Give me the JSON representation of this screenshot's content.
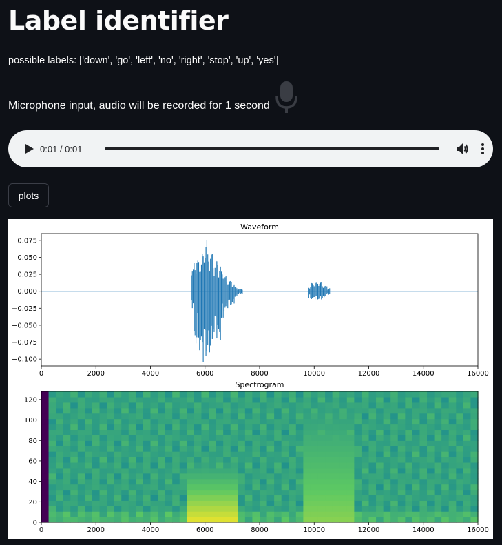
{
  "page": {
    "title": "Label identifier",
    "labels_text": "possible labels: ['down', 'go', 'left', 'no', 'right', 'stop', 'up', 'yes']",
    "mic_text": "Microphone input, audio will be recorded for 1 second",
    "mic_icon": "microphone-icon"
  },
  "audio": {
    "time": "0:01 / 0:01",
    "progress": 1.0,
    "icons": [
      "play-icon",
      "volume-icon",
      "more-vert-icon"
    ]
  },
  "plots_button": {
    "label": "plots"
  },
  "chart_data": [
    {
      "type": "line",
      "title": "Waveform",
      "xlabel": "",
      "ylabel": "",
      "xlim": [
        0,
        16000
      ],
      "ylim": [
        -0.11,
        0.085
      ],
      "xticks": [
        0,
        2000,
        4000,
        6000,
        8000,
        10000,
        12000,
        14000,
        16000
      ],
      "yticks": [
        -0.1,
        -0.075,
        -0.05,
        -0.025,
        0.0,
        0.025,
        0.05,
        0.075
      ],
      "xtick_labels": [
        "0",
        "2000",
        "4000",
        "6000",
        "8000",
        "10000",
        "12000",
        "14000",
        "16000"
      ],
      "ytick_labels": [
        "−0.100",
        "−0.075",
        "−0.050",
        "−0.025",
        "0.000",
        "0.025",
        "0.050",
        "0.075"
      ],
      "color": "#1f77b4",
      "series": [
        {
          "x": [
            0,
            5400,
            5500,
            5600,
            5700,
            5800,
            5900,
            6000,
            6100,
            6200,
            6300,
            6400,
            6500,
            6600,
            6700,
            6800,
            6900,
            7000,
            7100,
            7200,
            7400,
            9700,
            9800,
            9900,
            10000,
            10100,
            10200,
            10300,
            10400,
            10500,
            10600,
            10800,
            16000
          ],
          "y_max": [
            0.001,
            0.003,
            0.032,
            0.05,
            0.045,
            0.05,
            0.055,
            0.078,
            0.06,
            0.055,
            0.05,
            0.045,
            0.04,
            0.03,
            0.022,
            0.018,
            0.015,
            0.012,
            0.006,
            0.003,
            0.001,
            0.002,
            0.008,
            0.012,
            0.013,
            0.014,
            0.013,
            0.01,
            0.008,
            0.005,
            0.002,
            0.001,
            0.001
          ],
          "y_min": [
            -0.001,
            -0.003,
            -0.025,
            -0.08,
            -0.07,
            -0.09,
            -0.105,
            -0.103,
            -0.09,
            -0.08,
            -0.065,
            -0.07,
            -0.075,
            -0.04,
            -0.03,
            -0.025,
            -0.022,
            -0.018,
            -0.008,
            -0.004,
            -0.001,
            -0.002,
            -0.01,
            -0.012,
            -0.012,
            -0.013,
            -0.012,
            -0.01,
            -0.008,
            -0.005,
            -0.002,
            -0.001,
            -0.001
          ]
        }
      ]
    },
    {
      "type": "heatmap",
      "title": "Spectrogram",
      "xlim": [
        0,
        16000
      ],
      "ylim": [
        0,
        128
      ],
      "xticks": [
        0,
        2000,
        4000,
        6000,
        8000,
        10000,
        12000,
        14000,
        16000
      ],
      "yticks": [
        0,
        20,
        40,
        60,
        80,
        100,
        120
      ],
      "xtick_labels": [
        "0",
        "2000",
        "4000",
        "6000",
        "8000",
        "10000",
        "12000",
        "14000",
        "16000"
      ],
      "ytick_labels": [
        "0",
        "20",
        "40",
        "60",
        "80",
        "100",
        "120"
      ],
      "colormap": "viridis",
      "dark_columns_x": [
        [
          0,
          200
        ],
        [
          800,
          900
        ]
      ],
      "bright_regions": [
        {
          "x": [
            5300,
            7200
          ],
          "y": [
            0,
            62
          ],
          "level": 0.85
        },
        {
          "x": [
            9700,
            11500
          ],
          "y": [
            0,
            128
          ],
          "level": 0.7
        }
      ]
    }
  ]
}
